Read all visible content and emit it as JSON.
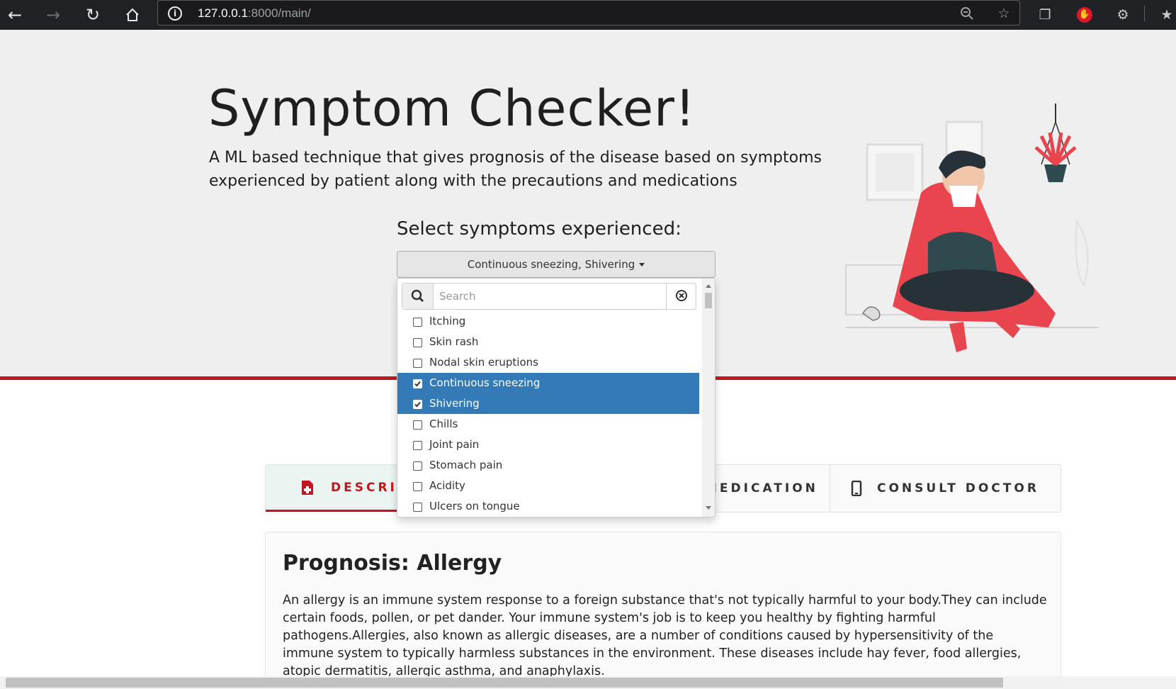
{
  "browser": {
    "url_host": "127.0.0.1",
    "url_path": ":8000/main/"
  },
  "hero": {
    "title": "Symptom Checker!",
    "subtitle": "A ML based technique that gives prognosis of the disease based on symptoms experienced by patient along with the precautions and medications",
    "select_label": "Select symptoms experienced:"
  },
  "dropdown": {
    "button_label": "Continuous sneezing, Shivering",
    "search_placeholder": "Search",
    "options": [
      {
        "label": "Itching",
        "checked": false
      },
      {
        "label": "Skin rash",
        "checked": false
      },
      {
        "label": "Nodal skin eruptions",
        "checked": false
      },
      {
        "label": "Continuous sneezing",
        "checked": true
      },
      {
        "label": "Shivering",
        "checked": true
      },
      {
        "label": "Chills",
        "checked": false
      },
      {
        "label": "Joint pain",
        "checked": false
      },
      {
        "label": "Stomach pain",
        "checked": false
      },
      {
        "label": "Acidity",
        "checked": false
      },
      {
        "label": "Ulcers on tongue",
        "checked": false
      }
    ]
  },
  "tabs": [
    {
      "label": "DESCRIPTION",
      "visible_label": "DESCRIPT",
      "icon": "medical-file-icon",
      "active": true
    },
    {
      "label": "MEDICATION",
      "icon": "pill-icon",
      "active": false
    },
    {
      "label": "CONSULT DOCTOR",
      "icon": "phone-icon",
      "active": false
    }
  ],
  "prognosis": {
    "heading": "Prognosis: Allergy",
    "text": "An allergy is an immune system response to a foreign substance that's not typically harmful to your body.They can include certain foods, pollen, or pet dander. Your immune system's job is to keep you healthy by fighting harmful pathogens.Allergies, also known as allergic diseases, are a number of conditions caused by hypersensitivity of the immune system to typically harmless substances in the environment. These diseases include hay fever, food allergies, atopic dermatitis, allergic asthma, and anaphylaxis."
  },
  "colors": {
    "accent_red": "#c1161f",
    "selected_blue": "#337ab7",
    "hero_bg": "#efefef"
  }
}
